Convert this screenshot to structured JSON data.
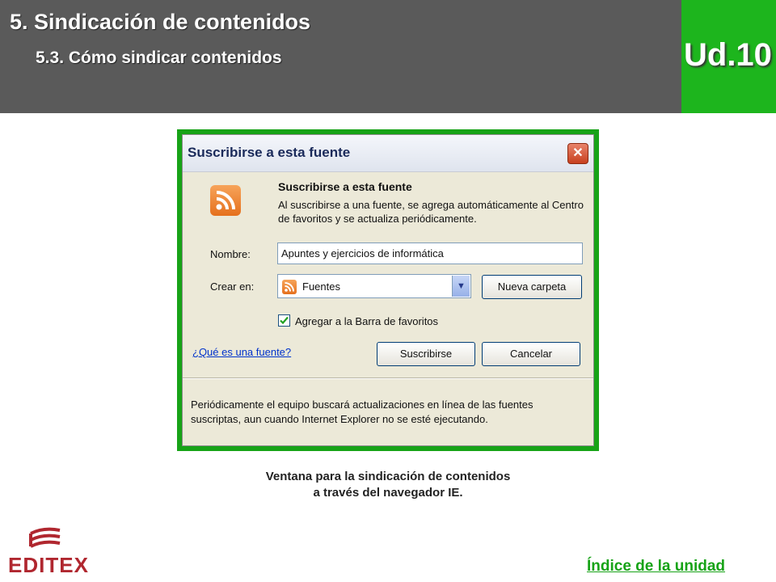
{
  "header": {
    "title": "5. Sindicación de contenidos",
    "subtitle": "5.3. Cómo sindicar contenidos",
    "unit": "Ud.10"
  },
  "dialog": {
    "title": "Suscribirse a esta fuente",
    "close_glyph": "✕",
    "heading": "Suscribirse a esta fuente",
    "description": "Al suscribirse a una fuente, se agrega automáticamente al Centro de favoritos y se actualiza periódicamente.",
    "name_label": "Nombre:",
    "name_value": "Apuntes y ejercicios de informática",
    "create_label": "Crear en:",
    "folder_selected": "Fuentes",
    "new_folder_button": "Nueva carpeta",
    "checkbox_label": "Agregar a la Barra de favoritos",
    "checkbox_checked": true,
    "help_link": "¿Qué es una fuente?",
    "subscribe_button": "Suscribirse",
    "cancel_button": "Cancelar",
    "footer_note": "Periódicamente el equipo buscará actualizaciones en línea de las fuentes suscriptas, aun cuando Internet Explorer no se esté ejecutando."
  },
  "caption": {
    "line1": "Ventana para la sindicación de contenidos",
    "line2": "a través del navegador IE."
  },
  "footer": {
    "logo_text": "EDITEX",
    "index_link": "Índice de la unidad"
  },
  "colors": {
    "header_bg": "#5a5a5a",
    "unit_bg": "#1db51d",
    "frame": "#17a317",
    "logo": "#b0272f"
  },
  "icons": {
    "rss": "rss-feed-icon",
    "close": "close-icon",
    "dropdown": "chevron-down-icon",
    "check": "checkmark-icon"
  }
}
